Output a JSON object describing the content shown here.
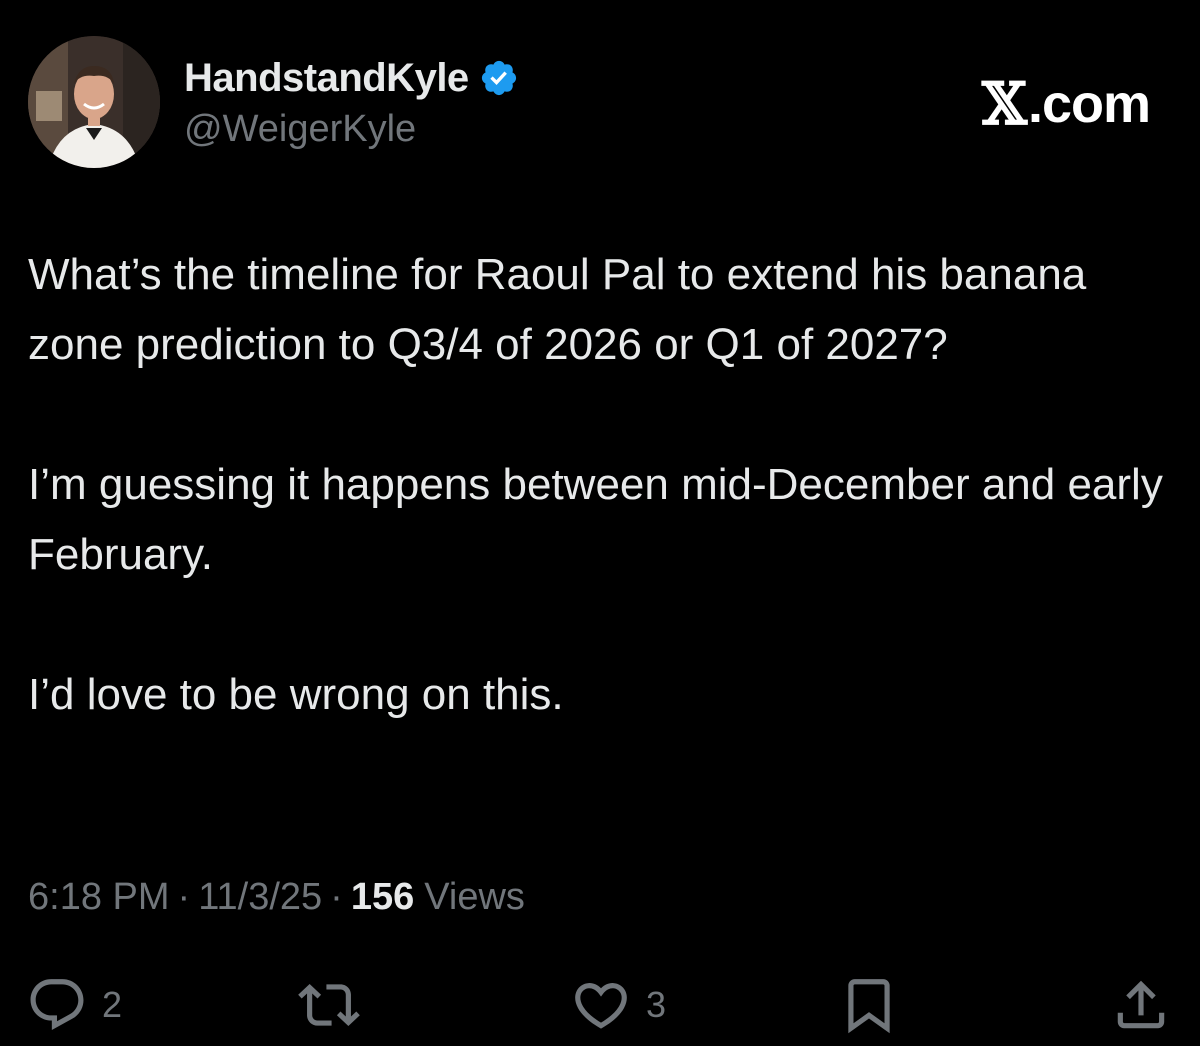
{
  "author": {
    "display_name": "HandstandKyle",
    "handle": "@WeigerKyle",
    "verified": true
  },
  "brand": {
    "x_glyph": "𝕏",
    "suffix": ".com"
  },
  "tweet": {
    "paragraphs": [
      "What’s the timeline for Raoul Pal to extend his banana zone prediction to Q3/4 of 2026 or Q1 of 2027?",
      "I’m guessing it happens between mid-December and early February.",
      "I’d love to be wrong on this."
    ]
  },
  "meta": {
    "time": "6:18 PM",
    "separator": "·",
    "date": "11/3/25",
    "views_count": "156",
    "views_label": "Views"
  },
  "actions": {
    "reply_count": "2",
    "retweet_count": "",
    "like_count": "3"
  },
  "colors": {
    "background": "#000000",
    "text_primary": "#e7e9ea",
    "text_secondary": "#71767b",
    "verified_blue": "#1d9bf0"
  }
}
